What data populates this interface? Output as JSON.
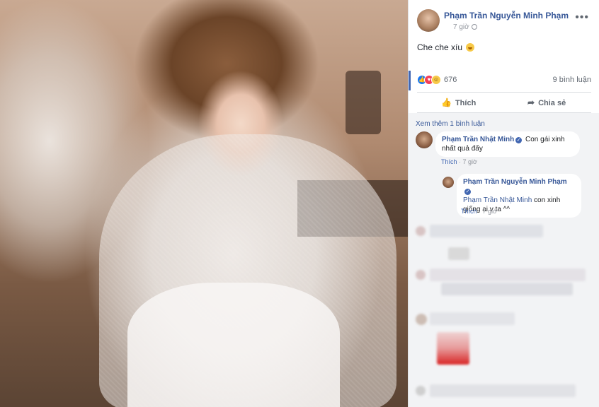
{
  "post": {
    "author": "Phạm Trần Nguyễn Minh Phạm",
    "time": "7 giờ",
    "caption": "Che che xíu",
    "reaction_count": "676",
    "comment_count": "9 bình luận",
    "reactions": [
      "like",
      "love",
      "haha"
    ]
  },
  "actions": {
    "like_label": "Thích",
    "share_label": "Chia sẻ"
  },
  "comments": {
    "see_more": "Xem thêm 1 bình luận",
    "items": [
      {
        "author": "Phạm Trần Nhật Minh",
        "text": "Con gái xinh nhất quả đấy",
        "like_label": "Thích",
        "time": "7 giờ"
      },
      {
        "author": "Phạm Trần Nguyễn Minh Phạm",
        "mention": "Phạm Trần Nhật Minh",
        "text": "con xinh giống ai v ta ^^",
        "like_label": "Thích",
        "time": "7 giờ"
      }
    ]
  },
  "colors": {
    "link": "#385898",
    "accent": "#4267b2",
    "muted": "#90949c",
    "comments_bg": "#f2f3f5"
  },
  "icons": {
    "like": "thumbs-up-icon",
    "share": "share-arrow-icon",
    "more": "more-dots-icon",
    "audience": "globe-icon"
  }
}
